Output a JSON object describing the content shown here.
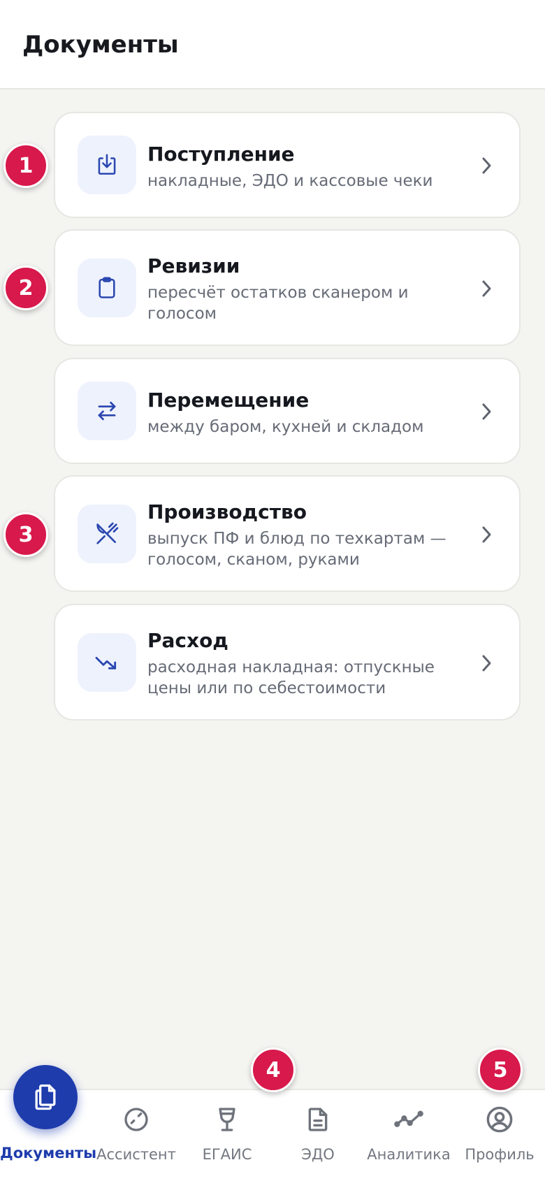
{
  "header": {
    "title": "Документы"
  },
  "cards": [
    {
      "title": "Поступление",
      "subtitle": "накладные, ЭДО и кассовые чеки",
      "icon": "download-icon"
    },
    {
      "title": "Ревизии",
      "subtitle": "пересчёт остатков сканером и голосом",
      "icon": "clipboard-icon"
    },
    {
      "title": "Перемещение",
      "subtitle": "между баром, кухней и складом",
      "icon": "transfer-arrows-icon"
    },
    {
      "title": "Производство",
      "subtitle": "выпуск ПФ и блюд по техкартам — голосом, сканом, руками",
      "icon": "fork-knife-icon"
    },
    {
      "title": "Расход",
      "subtitle": "расходная накладная: отпускные цены или по себестоимости",
      "icon": "trending-down-icon"
    }
  ],
  "markers": [
    "1",
    "2",
    "3",
    "4",
    "5"
  ],
  "tabbar": {
    "tabs": [
      {
        "label": "Документы",
        "icon": "documents-icon",
        "active": true
      },
      {
        "label": "Ассистент",
        "icon": "assistant-icon"
      },
      {
        "label": "ЕГАИС",
        "icon": "wine-glass-icon"
      },
      {
        "label": "ЭДО",
        "icon": "file-icon"
      },
      {
        "label": "Аналитика",
        "icon": "chart-line-icon"
      },
      {
        "label": "Профиль",
        "icon": "user-circle-icon"
      }
    ]
  },
  "colors": {
    "accent": "#1e3cac",
    "marker": "#d8194b",
    "background": "#f4f4f1"
  }
}
